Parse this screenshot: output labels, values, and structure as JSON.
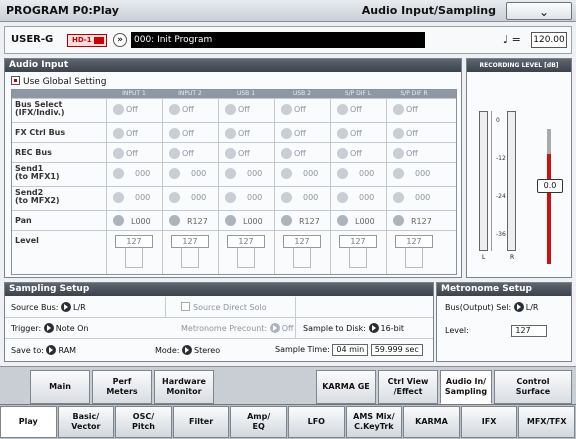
{
  "header": {
    "title": "PROGRAM P0:Play",
    "page": "Audio Input/Sampling"
  },
  "program": {
    "bank": "USER-G",
    "badge": "HD-1",
    "name": "000: Init Program",
    "tempo_symbol": "♩ =",
    "tempo": "120.00"
  },
  "audio_input": {
    "title": "Audio Input",
    "use_global": "Use Global Setting",
    "columns": [
      "INPUT 1",
      "INPUT 2",
      "USB 1",
      "USB 2",
      "S/P DIF L",
      "S/P DIF R"
    ],
    "rows": [
      {
        "label": "Bus Select\n(IFX/Indiv.)",
        "values": [
          "Off",
          "Off",
          "Off",
          "Off",
          "Off",
          "Off"
        ]
      },
      {
        "label": "FX Ctrl Bus",
        "values": [
          "Off",
          "Off",
          "Off",
          "Off",
          "Off",
          "Off"
        ]
      },
      {
        "label": "REC Bus",
        "values": [
          "Off",
          "Off",
          "Off",
          "Off",
          "Off",
          "Off"
        ]
      },
      {
        "label": "Send1\n(to MFX1)",
        "values": [
          "000",
          "000",
          "000",
          "000",
          "000",
          "000"
        ]
      },
      {
        "label": "Send2\n(to MFX2)",
        "values": [
          "000",
          "000",
          "000",
          "000",
          "000",
          "000"
        ]
      },
      {
        "label": "Pan",
        "values": [
          "L000",
          "R127",
          "L000",
          "R127",
          "L000",
          "R127"
        ]
      },
      {
        "label": "Level",
        "values": [
          "127",
          "127",
          "127",
          "127",
          "127",
          "127"
        ]
      }
    ]
  },
  "recording_level": {
    "title": "RECORDING LEVEL [dB]",
    "ticks": [
      "0",
      "-12",
      "-24",
      "-36"
    ],
    "left": "L",
    "right": "R",
    "fader_value": "0.0"
  },
  "sampling_setup": {
    "title": "Sampling Setup",
    "source_bus_label": "Source Bus:",
    "source_bus": "L/R",
    "source_direct_solo": "Source Direct Solo",
    "trigger_label": "Trigger:",
    "trigger": "Note On",
    "metronome_precount_label": "Metronome Precount:",
    "metronome_precount": "Off",
    "sample_to_disk_label": "Sample to Disk:",
    "sample_to_disk": "16-bit",
    "save_to_label": "Save to:",
    "save_to": "RAM",
    "mode_label": "Mode:",
    "mode": "Stereo",
    "sample_time_label": "Sample Time:",
    "sample_time_min": "04 min",
    "sample_time_sec": "59.999 sec"
  },
  "metronome_setup": {
    "title": "Metronome Setup",
    "bus_label": "Bus(Output) Sel:",
    "bus": "L/R",
    "level_label": "Level:",
    "level": "127"
  },
  "tabs_top": [
    "Main",
    "Perf\nMeters",
    "Hardware\nMonitor",
    "KARMA GE",
    "Ctrl View\n/Effect",
    "Audio In/\nSampling",
    "Control\nSurface"
  ],
  "tabs_bottom": [
    "Play",
    "Basic/\nVector",
    "OSC/\nPitch",
    "Filter",
    "Amp/\nEQ",
    "LFO",
    "AMS Mix/\nC.KeyTrk",
    "KARMA",
    "IFX",
    "MFX/TFX"
  ]
}
